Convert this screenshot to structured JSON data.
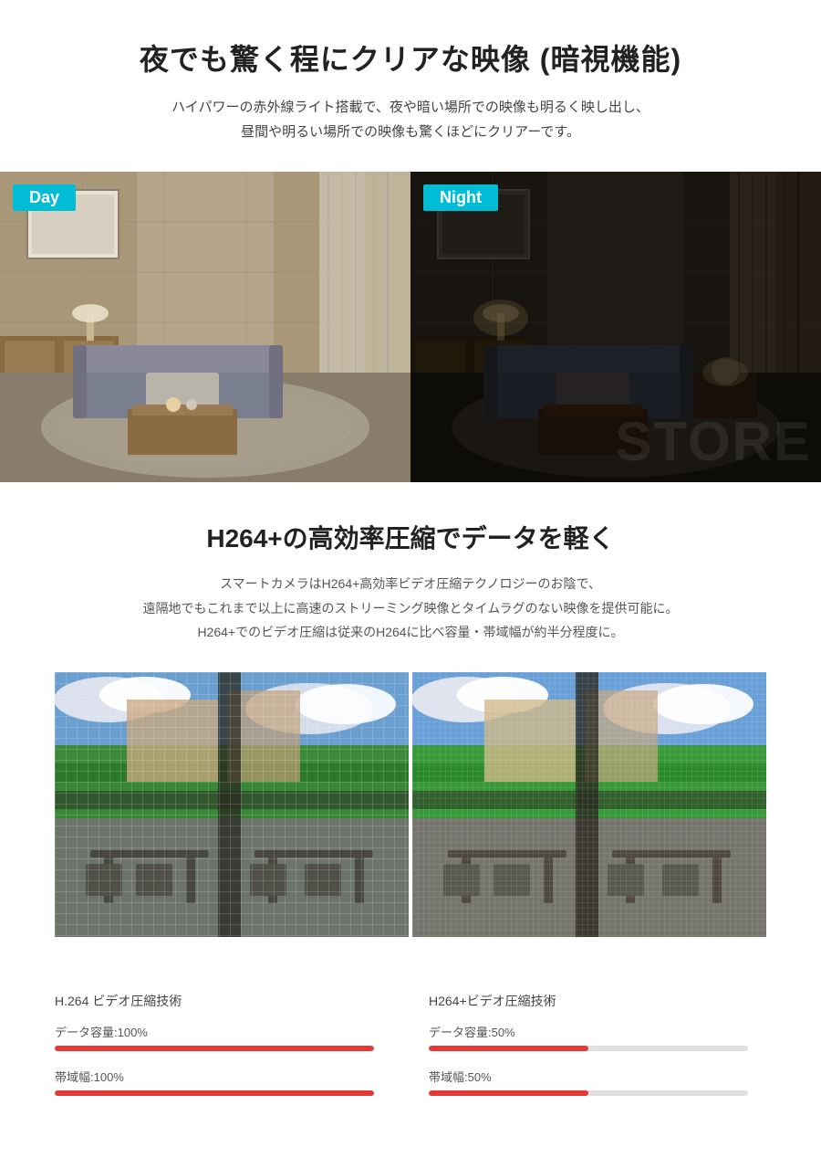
{
  "night_section": {
    "title": "夜でも驚く程にクリアな映像 (暗視機能)",
    "subtitle_line1": "ハイパワーの赤外線ライト搭載で、夜や暗い場所での映像も明るく映し出し、",
    "subtitle_line2": "昼間や明るい場所での映像も驚くほどにクリアーです。",
    "day_label": "Day",
    "night_label": "Night"
  },
  "h264_section": {
    "title": "H264+の高効率圧縮でデータを軽く",
    "subtitle_line1": "スマートカメラはH264+高効率ビデオ圧縮テクノロジーのお陰で、",
    "subtitle_line2": "遠隔地でもこれまで以上に高速のストリーミング映像とタイムラグのない映像を提供可能に。",
    "subtitle_line3": "H264+でのビデオ圧縮は従来のH264に比べ容量・帯域幅が約半分程度に。"
  },
  "stats": {
    "left": {
      "title": "H.264 ビデオ圧縮技術",
      "data_label": "データ容量:100%",
      "data_pct": 100,
      "bandwidth_label": "帯域幅:100%",
      "bandwidth_pct": 100
    },
    "right": {
      "title": "H264+ビデオ圧縮技術",
      "data_label": "データ容量:50%",
      "data_pct": 50,
      "bandwidth_label": "帯域幅:50%",
      "bandwidth_pct": 50
    }
  },
  "colors": {
    "accent_cyan": "#00bcd4",
    "accent_red": "#e53935",
    "progress_bg": "#e0e0e0"
  }
}
